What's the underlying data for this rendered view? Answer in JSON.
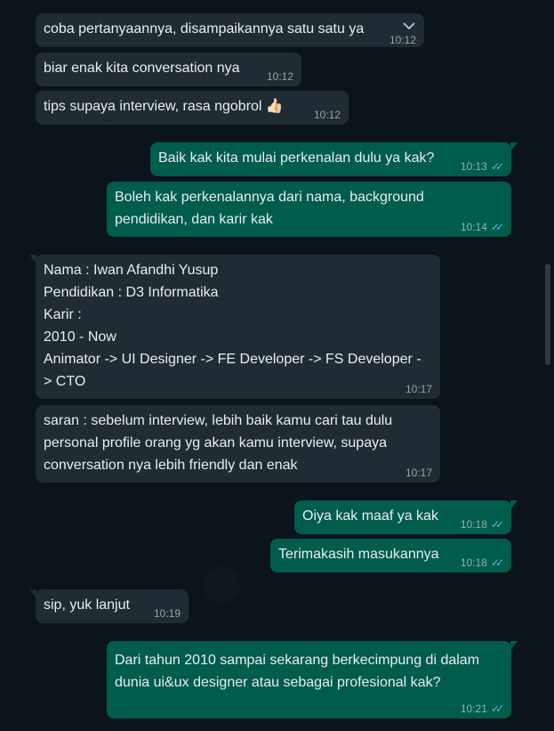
{
  "messages": [
    {
      "text": "coba pertanyaannya, disampaikannya satu satu ya",
      "time": "10:12"
    },
    {
      "text": "biar enak kita conversation nya",
      "time": "10:12"
    },
    {
      "text": "tips supaya interview, rasa ngobrol 👍🏻",
      "time": "10:12"
    },
    {
      "text": "Baik kak kita mulai perkenalan dulu ya kak?",
      "time": "10:13",
      "status": "read"
    },
    {
      "text": "Boleh kak perkenalannya dari nama, background\npendidikan, dan karir kak",
      "time": "10:14",
      "status": "read"
    },
    {
      "text": "Nama : Iwan Afandhi Yusup\nPendidikan : D3 Informatika\nKarir :\n2010 - Now\nAnimator -> UI Designer -> FE Developer -> FS Developer -\n> CTO",
      "time": "10:17"
    },
    {
      "text": "saran : sebelum interview, lebih baik kamu cari tau dulu\npersonal profile orang yg akan kamu interview, supaya\nconversation nya lebih friendly dan enak",
      "time": "10:17"
    },
    {
      "text": "Oiya kak maaf ya kak",
      "time": "10:18",
      "status": "read"
    },
    {
      "text": "Terimakasih masukannya",
      "time": "10:18",
      "status": "read"
    },
    {
      "text": "sip, yuk lanjut",
      "time": "10:19"
    },
    {
      "text": "Dari tahun 2010 sampai sekarang berkecimpung di dalam\ndunia ui&ux designer atau sebagai profesional kak?",
      "time": "10:21",
      "status": "read"
    }
  ],
  "read_ticks": "✓✓",
  "colors": {
    "background": "#0b141a",
    "incoming": "#202c33",
    "outgoing": "#005c4b",
    "read_tick": "#53bdeb"
  },
  "icons": {
    "menu": "chevron-down-icon",
    "read_status": "double-check-icon"
  }
}
